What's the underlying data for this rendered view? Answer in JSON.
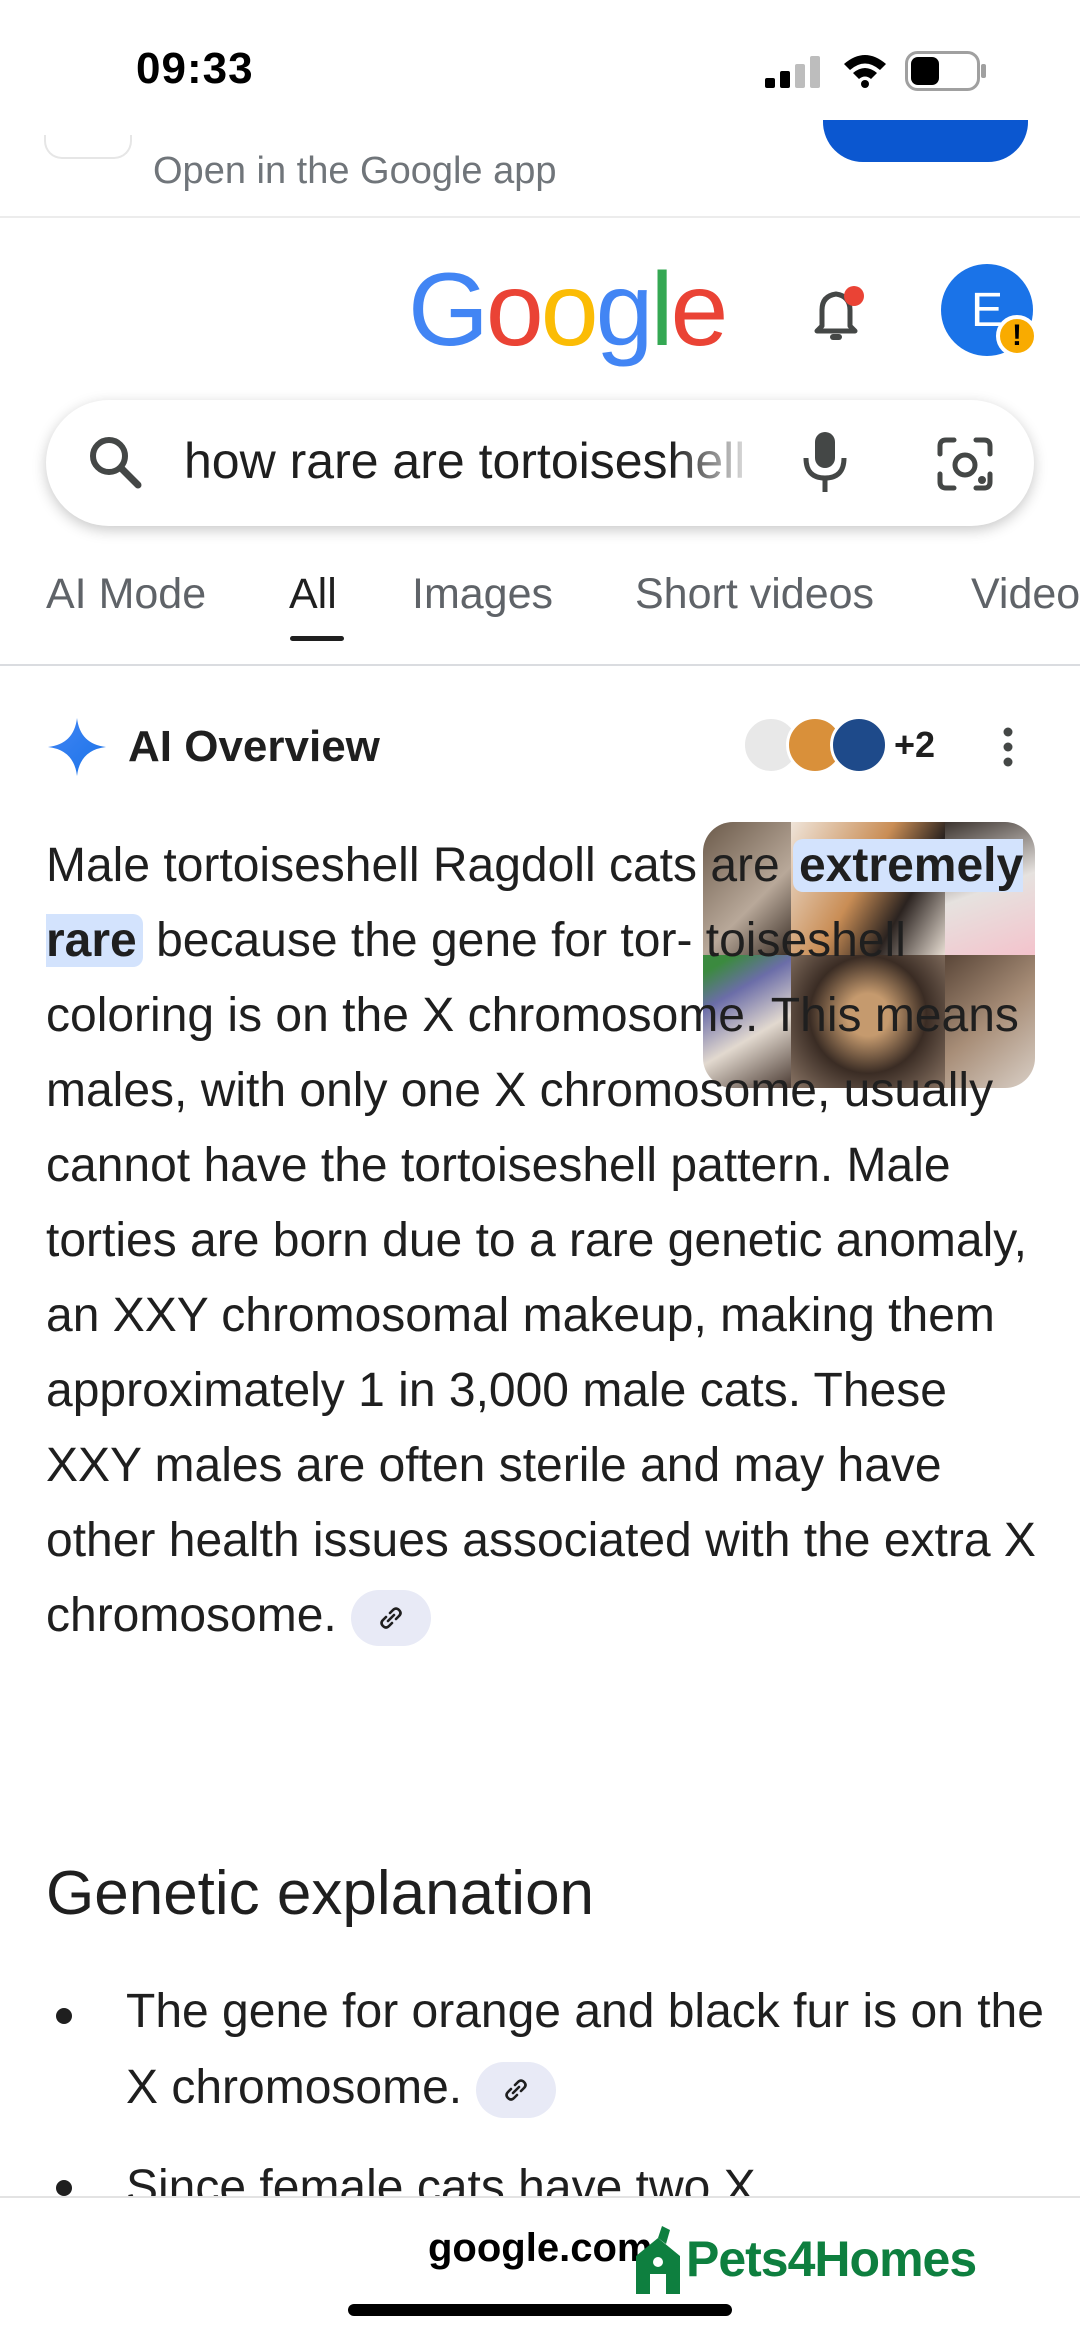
{
  "status_bar": {
    "time": "09:33"
  },
  "banner": {
    "text": "Open in the Google app"
  },
  "header": {
    "logo": [
      "G",
      "o",
      "o",
      "g",
      "l",
      "e"
    ],
    "avatar_initial": "E",
    "avatar_badge": "!"
  },
  "search": {
    "query": "how rare are tortoiseshell male ragdoll cats"
  },
  "tabs": [
    {
      "label": "AI Mode"
    },
    {
      "label": "All",
      "active": true
    },
    {
      "label": "Images"
    },
    {
      "label": "Short videos"
    },
    {
      "label": "Videos"
    }
  ],
  "ai_overview": {
    "title": "AI Overview",
    "sources_more": "+2",
    "answer": {
      "part1": "Male tortoiseshell Ragdoll cats are ",
      "highlight": "extremely rare",
      "part2": " because the gene for tor- toiseshell coloring is on the X chromosome. This means males, with only one X chromosome, usually cannot have the tortoiseshell pattern. Male torties are born due to a rare genetic anomaly, an XXY chromosomal makeup, making them approximately 1 in 3,000 male cats. These XXY males are often sterile and may have other health issues associated with the extra X chromosome."
    },
    "section_title": "Genetic explanation",
    "bullets": [
      "The gene for orange and black fur is on the X chromosome.",
      "Since female cats have two X"
    ]
  },
  "bottom": {
    "url": "google.com",
    "overlay_brand": "Pets4Homes"
  },
  "colors": {
    "google_blue": "#4285f4",
    "google_red": "#ea4335",
    "google_yellow": "#fbbc05",
    "google_green": "#34a853",
    "highlight": "#d3e3fd",
    "brand_green": "#0e7f3f"
  }
}
